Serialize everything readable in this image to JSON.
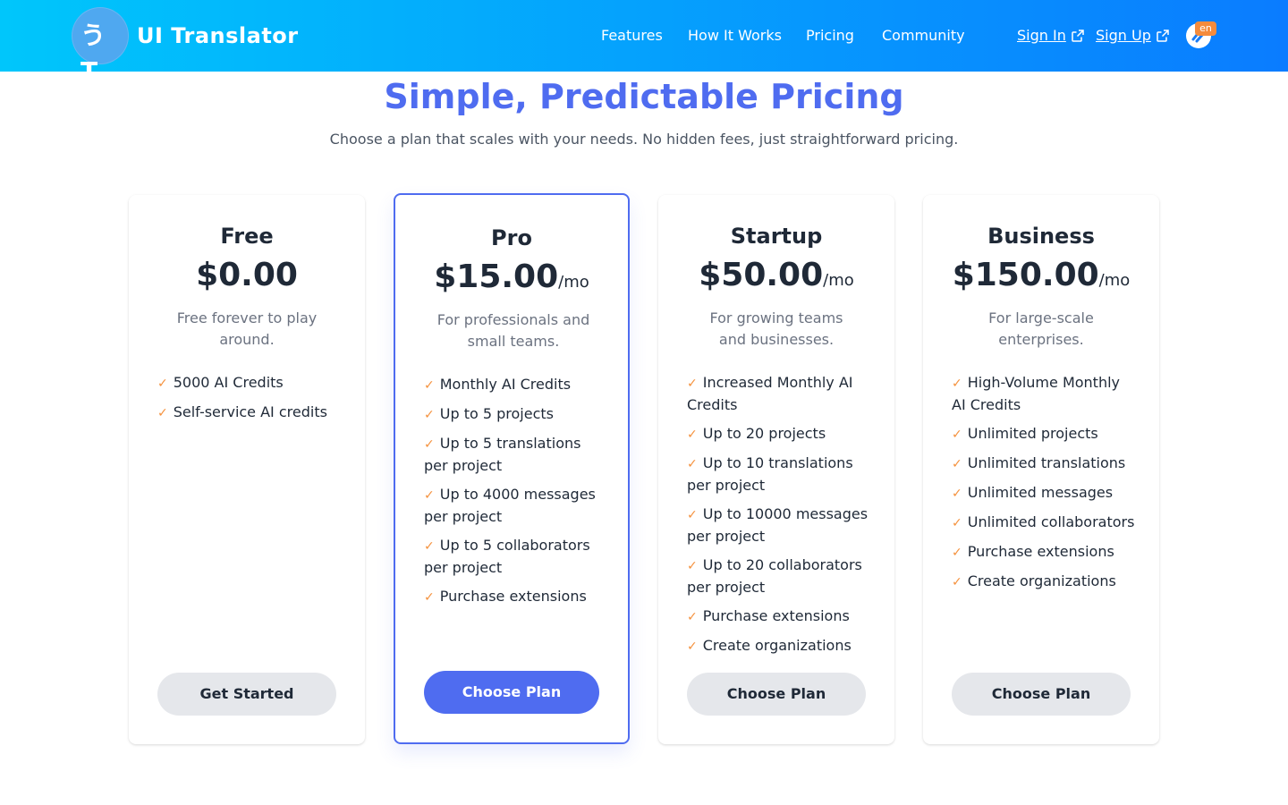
{
  "header": {
    "logo_text": "うT",
    "brand": "UI Translator",
    "nav": [
      "Features",
      "How It Works",
      "Pricing",
      "Community"
    ],
    "sign_in": "Sign In",
    "sign_up": "Sign Up",
    "language_badge": "en"
  },
  "main": {
    "title": "Simple, Predictable Pricing",
    "subtitle": "Choose a plan that scales with your needs. No hidden fees, just straightforward pricing."
  },
  "plans": [
    {
      "name": "Free",
      "price": "$0.00",
      "period": "",
      "description": "Free forever to play around.",
      "features": [
        "5000 AI Credits",
        "Self-service AI credits"
      ],
      "button": "Get Started"
    },
    {
      "name": "Pro",
      "price": "$15.00",
      "period": "/mo",
      "description": "For professionals and small teams.",
      "features": [
        "Monthly AI Credits",
        "Up to 5 projects",
        "Up to 5 translations per project",
        "Up to 4000 messages per project",
        "Up to 5 collaborators per project",
        "Purchase extensions"
      ],
      "button": "Choose Plan"
    },
    {
      "name": "Startup",
      "price": "$50.00",
      "period": "/mo",
      "description": "For growing teams and businesses.",
      "features": [
        "Increased Monthly AI Credits",
        "Up to 20 projects",
        "Up to 10 translations per project",
        "Up to 10000 messages per project",
        "Up to 20 collaborators per project",
        "Purchase extensions",
        "Create organizations"
      ],
      "button": "Choose Plan"
    },
    {
      "name": "Business",
      "price": "$150.00",
      "period": "/mo",
      "description": "For large-scale enterprises.",
      "features": [
        "High-Volume Monthly AI Credits",
        "Unlimited projects",
        "Unlimited translations",
        "Unlimited messages",
        "Unlimited collaborators",
        "Purchase extensions",
        "Create organizations"
      ],
      "button": "Choose Plan"
    }
  ],
  "colors": {
    "accent": "#4f6cf0",
    "check": "#f5923e",
    "header_start": "#00c6fb",
    "header_end": "#0a7cff"
  }
}
